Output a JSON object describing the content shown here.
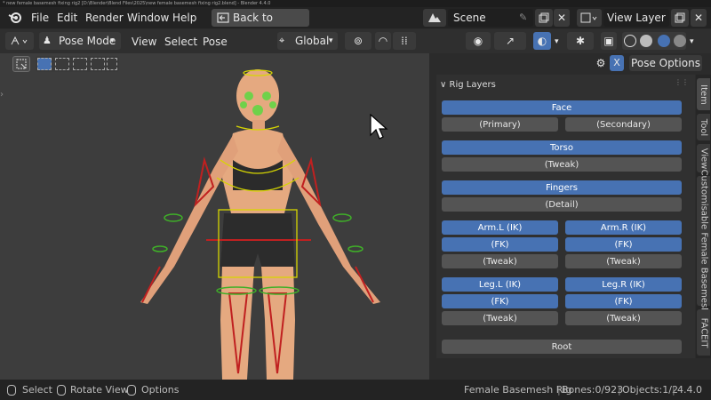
{
  "window": {
    "title": "* new female basemesh fixing rig2 [D:\\Blender\\Blend Files\\2025\\new female basemesh fixing rig2.blend] - Blender 4.4.0"
  },
  "menu": {
    "file": "File",
    "edit": "Edit",
    "render": "Render",
    "window": "Window",
    "help": "Help",
    "back": "Back to Previous"
  },
  "scene": {
    "name": "Scene",
    "view_layer": "View Layer"
  },
  "header": {
    "mode": "Pose Mode",
    "view": "View",
    "select": "Select",
    "pose": "Pose",
    "orientation": "Global"
  },
  "npanel": {
    "close": "X",
    "pose_options": "Pose Options",
    "title": "Rig Layers",
    "buttons": {
      "face": "Face",
      "face_primary": "(Primary)",
      "face_secondary": "(Secondary)",
      "torso": "Torso",
      "torso_tweak": "(Tweak)",
      "fingers": "Fingers",
      "fingers_detail": "(Detail)",
      "arm_l_ik": "Arm.L (IK)",
      "arm_r_ik": "Arm.R (IK)",
      "arm_l_fk": "(FK)",
      "arm_r_fk": "(FK)",
      "arm_l_tweak": "(Tweak)",
      "arm_r_tweak": "(Tweak)",
      "leg_l_ik": "Leg.L (IK)",
      "leg_r_ik": "Leg.R (IK)",
      "leg_l_fk": "(FK)",
      "leg_r_fk": "(FK)",
      "leg_l_tweak": "(Tweak)",
      "leg_r_tweak": "(Tweak)",
      "root": "Root"
    },
    "tabs": {
      "item": "Item",
      "tool": "Tool",
      "view": "View",
      "custom": "Customisable Female Basemesh",
      "facet": "FACEIT"
    }
  },
  "status": {
    "select": "Select",
    "rotate": "Rotate View",
    "options": "Options",
    "rig": "Female Basemesh Rig",
    "bones": "Bones:0/923",
    "objects": "Objects:1/2",
    "version": "4.4.0"
  },
  "colors": {
    "accent": "#4772b3",
    "button": "#545454",
    "panel": "#303030",
    "viewport": "#3d3d3d"
  }
}
